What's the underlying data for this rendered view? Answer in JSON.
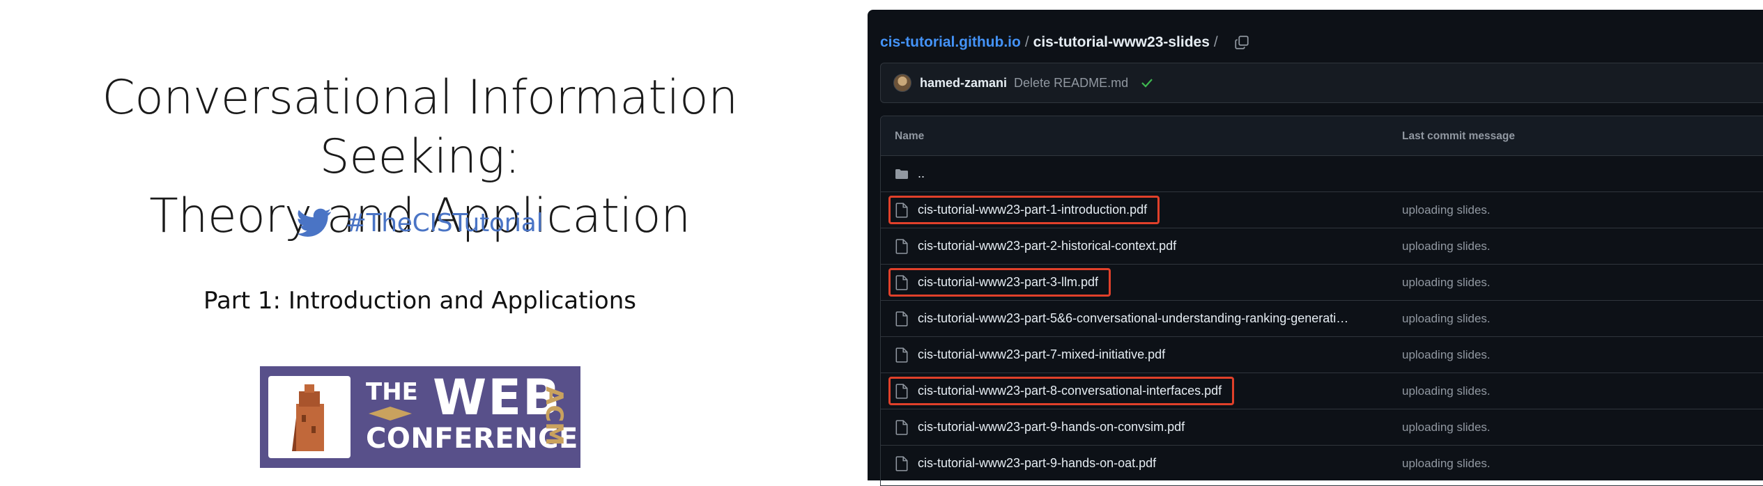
{
  "slide": {
    "title_line1": "Conversational Information Seeking:",
    "title_line2": "Theory and Application",
    "hashtag": "#TheCISTutorial",
    "part_label": "Part 1: Introduction and Applications",
    "logo": {
      "the": "THE",
      "web": "WEB",
      "conference": "CONFERENCE",
      "acm": "ACM",
      "color_bg": "#58508a",
      "color_acm": "#c9a25e"
    },
    "hashtag_color": "#4a74c5"
  },
  "github": {
    "breadcrumb": {
      "repo": "cis-tutorial.github.io",
      "separator": "/",
      "folder": "cis-tutorial-www23-slides",
      "trailing": "/"
    },
    "commit": {
      "user": "hamed-zamani",
      "message": "Delete README.md",
      "status_icon": "check-icon"
    },
    "table": {
      "header_name": "Name",
      "header_message": "Last commit message",
      "parent_dir": "..",
      "files": [
        {
          "name": "cis-tutorial-www23-part-1-introduction.pdf",
          "message": "uploading slides.",
          "highlighted": true
        },
        {
          "name": "cis-tutorial-www23-part-2-historical-context.pdf",
          "message": "uploading slides.",
          "highlighted": false
        },
        {
          "name": "cis-tutorial-www23-part-3-llm.pdf",
          "message": "uploading slides.",
          "highlighted": true
        },
        {
          "name": "cis-tutorial-www23-part-5&6-conversational-understanding-ranking-generati…",
          "message": "uploading slides.",
          "highlighted": false
        },
        {
          "name": "cis-tutorial-www23-part-7-mixed-initiative.pdf",
          "message": "uploading slides.",
          "highlighted": false
        },
        {
          "name": "cis-tutorial-www23-part-8-conversational-interfaces.pdf",
          "message": "uploading slides.",
          "highlighted": true
        },
        {
          "name": "cis-tutorial-www23-part-9-hands-on-convsim.pdf",
          "message": "uploading slides.",
          "highlighted": false
        },
        {
          "name": "cis-tutorial-www23-part-9-hands-on-oat.pdf",
          "message": "uploading slides.",
          "highlighted": false
        }
      ]
    },
    "colors": {
      "background": "#0d1117",
      "link": "#4493f8",
      "highlight": "#e0402a",
      "check": "#3fb950"
    }
  }
}
